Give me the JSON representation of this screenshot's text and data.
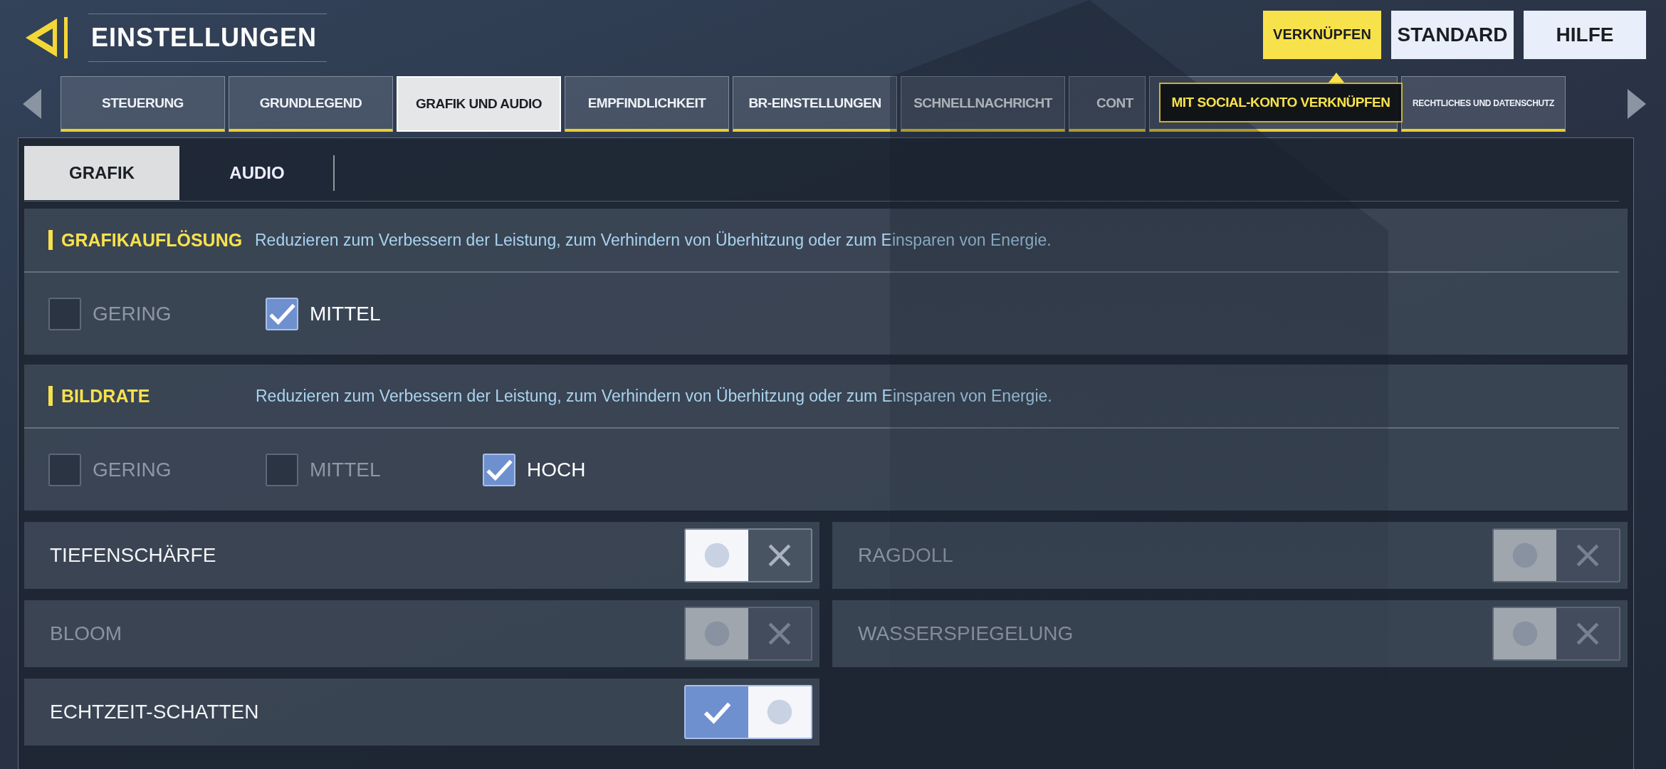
{
  "header": {
    "title": "EINSTELLUNGEN"
  },
  "top_buttons": [
    {
      "label": "VERKNÜPFEN",
      "kind": "primary"
    },
    {
      "label": "STANDARD",
      "kind": "plain"
    },
    {
      "label": "HILFE",
      "kind": "plain"
    }
  ],
  "tooltip": {
    "text": "MIT SOCIAL-KONTO VERKNÜPFEN"
  },
  "tabs": [
    {
      "label": "STEUERUNG",
      "selected": false
    },
    {
      "label": "GRUNDLEGEND",
      "selected": false
    },
    {
      "label": "GRAFIK UND AUDIO",
      "selected": true
    },
    {
      "label": "EMPFINDLICHKEIT",
      "selected": false
    },
    {
      "label": "BR-EINSTELLUNGEN",
      "selected": false
    },
    {
      "label": "SCHNELLNACHRICHT",
      "selected": false
    },
    {
      "label": "CONT",
      "selected": false
    },
    {
      "selected": false
    },
    {
      "label": "RECHTLICHES UND DATENSCHUTZ",
      "selected": false
    }
  ],
  "subtabs": [
    {
      "label": "GRAFIK",
      "selected": true
    },
    {
      "label": "AUDIO",
      "selected": false
    }
  ],
  "sections": [
    {
      "title": "GRAFIKAUFLÖSUNG",
      "description": "Reduzieren zum Verbessern der Leistung, zum Verhindern von Überhitzung oder zum Einsparen von Energie.",
      "options": [
        {
          "label": "GERING",
          "checked": false
        },
        {
          "label": "MITTEL",
          "checked": true
        }
      ]
    },
    {
      "title": "BILDRATE",
      "description": "Reduzieren zum Verbessern der Leistung, zum Verhindern von Überhitzung oder zum Einsparen von Energie.",
      "options": [
        {
          "label": "GERING",
          "checked": false
        },
        {
          "label": "MITTEL",
          "checked": false
        },
        {
          "label": "HOCH",
          "checked": true
        }
      ]
    }
  ],
  "toggles": [
    {
      "label": "TIEFENSCHÄRFE",
      "on": false,
      "disabled": false
    },
    {
      "label": "RAGDOLL",
      "on": false,
      "disabled": true
    },
    {
      "label": "BLOOM",
      "on": false,
      "disabled": true
    },
    {
      "label": "WASSERSPIEGELUNG",
      "on": false,
      "disabled": true
    },
    {
      "label": "ECHTZEIT-SCHATTEN",
      "on": true,
      "disabled": false
    }
  ]
}
